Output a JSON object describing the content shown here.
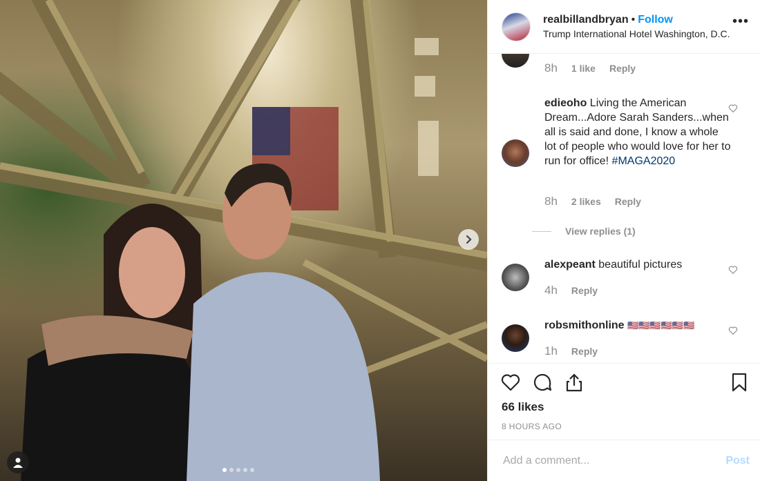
{
  "post": {
    "username": "realbillandbryan",
    "follow_label": "Follow",
    "location": "Trump International Hotel Washington, D.C.",
    "more_icon": "more-options-icon"
  },
  "comments": [
    {
      "username": "",
      "text": "",
      "time": "8h",
      "likes": "1 like",
      "reply": "Reply"
    },
    {
      "username": "edieoho",
      "text": "Living the American Dream...Adore Sarah Sanders...when all is said and done, I know a whole lot of people who would love for her to run for office!",
      "hashtag": "#MAGA2020",
      "time": "8h",
      "likes": "2 likes",
      "reply": "Reply",
      "view_replies": "View replies (1)"
    },
    {
      "username": "alexpeant",
      "text": "beautiful pictures",
      "time": "4h",
      "reply": "Reply"
    },
    {
      "username": "robsmithonline",
      "text": "🇺🇸🇺🇸🇺🇸🇺🇸🇺🇸🇺🇸",
      "time": "1h",
      "reply": "Reply"
    }
  ],
  "actions": {
    "likes_count": "66 likes",
    "date": "8 HOURS AGO"
  },
  "add_comment": {
    "placeholder": "Add a comment...",
    "post_label": "Post"
  },
  "carousel": {
    "slide_count": 5,
    "active": 0
  },
  "colors": {
    "link": "#0095f6",
    "muted": "#8e8e8e",
    "post_disabled": "#b3dbff"
  }
}
